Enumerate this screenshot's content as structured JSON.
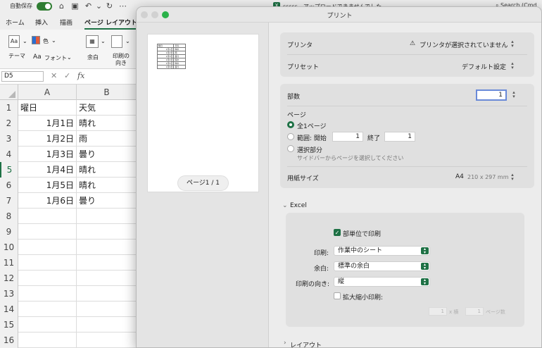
{
  "excel": {
    "titlebar": {
      "autosave": "自動保存",
      "file_badge": "X",
      "file_title": "sssss - アップロードできませんでした",
      "search": "Search (Cmd"
    },
    "ribbon_tabs": [
      "ホーム",
      "挿入",
      "描画",
      "ページ レイアウト"
    ],
    "ribbon": {
      "theme": "テーマ",
      "theme_icon": "Aa",
      "color": "色",
      "font": "フォント",
      "font_icon": "Aa",
      "margins": "余白",
      "orientation_1": "印刷の",
      "orientation_2": "向き"
    },
    "formula_bar": {
      "namebox": "D5",
      "cancel": "✕",
      "ok": "✓",
      "fx": "fx"
    },
    "columns": [
      "A",
      "B"
    ],
    "rows": [
      {
        "n": "1",
        "a": "曜日",
        "b": "天気"
      },
      {
        "n": "2",
        "a": "1月1日",
        "b": "晴れ"
      },
      {
        "n": "3",
        "a": "1月2日",
        "b": "雨"
      },
      {
        "n": "4",
        "a": "1月3日",
        "b": "曇り"
      },
      {
        "n": "5",
        "a": "1月4日",
        "b": "晴れ"
      },
      {
        "n": "6",
        "a": "1月5日",
        "b": "晴れ"
      },
      {
        "n": "7",
        "a": "1月6日",
        "b": "曇り"
      },
      {
        "n": "8",
        "a": "",
        "b": ""
      },
      {
        "n": "9",
        "a": "",
        "b": ""
      },
      {
        "n": "10",
        "a": "",
        "b": ""
      },
      {
        "n": "11",
        "a": "",
        "b": ""
      },
      {
        "n": "12",
        "a": "",
        "b": ""
      },
      {
        "n": "13",
        "a": "",
        "b": ""
      },
      {
        "n": "14",
        "a": "",
        "b": ""
      },
      {
        "n": "15",
        "a": "",
        "b": ""
      },
      {
        "n": "16",
        "a": "",
        "b": ""
      }
    ]
  },
  "dialog": {
    "title": "プリント",
    "preview": {
      "page_indicator": "ページ1 / 1",
      "thumb_rows": [
        [
          "曜日",
          "天気"
        ],
        [
          "1月1日",
          "晴れ"
        ],
        [
          "1月2日",
          "雨"
        ],
        [
          "1月3日",
          "曇り"
        ],
        [
          "1月4日",
          "晴れ"
        ],
        [
          "1月5日",
          "晴れ"
        ],
        [
          "1月6日",
          "曇り"
        ]
      ]
    },
    "printer": {
      "label": "プリンタ",
      "value": "プリンタが選択されていません",
      "warning_icon": "⚠"
    },
    "preset": {
      "label": "プリセット",
      "value": "デフォルト設定"
    },
    "copies": {
      "label": "部数",
      "value": "1"
    },
    "pages": {
      "label": "ページ",
      "all": "全1ページ",
      "range": "範囲: 開始",
      "range_from": "1",
      "range_to_label": "終了",
      "range_to": "1",
      "selection": "選択部分",
      "selection_hint": "サイドバーからページを選択してください"
    },
    "paper": {
      "label": "用紙サイズ",
      "size": "A4",
      "dims": "210 x 297 mm"
    },
    "excel_section": {
      "header": "Excel",
      "collate": "部単位で印刷",
      "print_label": "印刷:",
      "print_value": "作業中のシート",
      "margins_label": "余白:",
      "margins_value": "標準の余白",
      "orientation_label": "印刷の向き:",
      "orientation_value": "縦",
      "scaling": "拡大縮小印刷:",
      "fit_width": "1",
      "fit_x": "x 横",
      "fit_height": "1",
      "fit_pages": "ページ数"
    },
    "layout_section": {
      "header": "レイアウト"
    }
  },
  "colors": {
    "accent": "#1e7145",
    "traffic_close": "#d1d1d1",
    "traffic_green": "#2ab24a"
  }
}
